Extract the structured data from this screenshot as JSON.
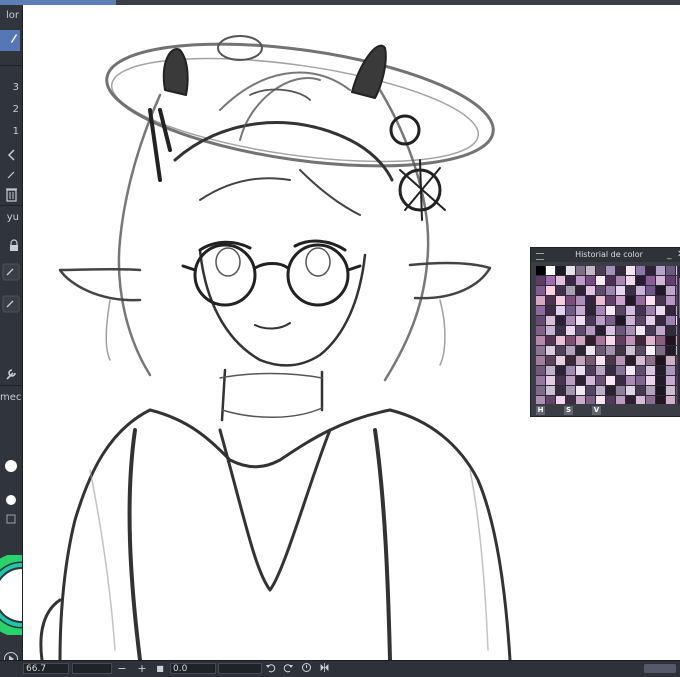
{
  "app": {
    "left_panel": {
      "header_text": "lor",
      "numbers": [
        "3",
        "2",
        "1"
      ],
      "labels": [
        "yu",
        "mec"
      ]
    },
    "icons": [
      "trash-icon",
      "lock-icon",
      "wrench-icon",
      "color-wheel-icon",
      "play-icon",
      "undo-icon",
      "redo-icon",
      "reset-rotation-icon",
      "flip-icon"
    ],
    "accent_color": "#5577b6"
  },
  "status_bar": {
    "zoom_value": "66.7",
    "zoom_out_label": "−",
    "zoom_in_label": "+",
    "stop_label": "■",
    "rotation_value": "0.0"
  },
  "palette_window": {
    "title": "Historial de color",
    "minimize_label": "_",
    "close_label": "✕",
    "footer_buttons": [
      "H",
      "S",
      "V"
    ],
    "swatch_colors": [
      "#000000",
      "#ffffff",
      "#1d1b22",
      "#e8e3ea",
      "#7d6f86",
      "#c2b8c7",
      "#4a3f52",
      "#a592b8",
      "#312a3a",
      "#f4e6f0",
      "#8c79a6",
      "#2d2338",
      "#b6a2c6",
      "#6a5b7a",
      "#d9c7e0",
      "#5a3e63",
      "#9b6fa8",
      "#e0c1d8",
      "#3b2745",
      "#c09ac7",
      "#774b80",
      "#fbe9f4",
      "#4e3056",
      "#a887b5",
      "#efd8e8",
      "#291b31",
      "#8a5e95",
      "#d4b4d6",
      "#613f6c",
      "#b28fbf",
      "#7e5f8f",
      "#fcd1dc",
      "#40324c",
      "#a7a1b3",
      "#2a2435",
      "#dfc3e3",
      "#5c4b6b",
      "#9e86b0",
      "#e6d7ec",
      "#3a2f46",
      "#c7b4d4",
      "#70598a",
      "#1f1a27",
      "#bba8c9",
      "#826d98",
      "#d6a9c2",
      "#4b3253",
      "#f2cde0",
      "#7a4d7c",
      "#ab8fbb",
      "#34233c",
      "#e9bcd2",
      "#5f426b",
      "#c9a3c9",
      "#221828",
      "#926a9c",
      "#fbe2ee",
      "#48354f",
      "#b797c4",
      "#6d4d78",
      "#8e6b9d",
      "#3c2d47",
      "#e3d0ea",
      "#6f5c80",
      "#c4aed0",
      "#2e2438",
      "#a487b2",
      "#f6e9f3",
      "#564464",
      "#d2bbdc",
      "#423350",
      "#9c81ad",
      "#ecdcef",
      "#31263b",
      "#bfa9cb",
      "#654a73",
      "#d8bfd9",
      "#2b1f33",
      "#a98bb5",
      "#f0dff0",
      "#4a3857",
      "#bb9fc6",
      "#7a5f88",
      "#1d1624",
      "#cdb3d6",
      "#5b4567",
      "#e5cfe6",
      "#37283f",
      "#9f82ad",
      "#f9eef7",
      "#7d6289",
      "#c9b3d2",
      "#3e3048",
      "#ead9ee",
      "#5e4a6c",
      "#b39cc0",
      "#271e2f",
      "#d7c3df",
      "#6c5679",
      "#a890b5",
      "#f3e7f4",
      "#493a55",
      "#c0a8ca",
      "#342a3d",
      "#8f769c",
      "#b48aa8",
      "#52364f",
      "#e6c0d4",
      "#7a506f",
      "#cfa6c0",
      "#2f1e2c",
      "#a47698",
      "#f4dbe8",
      "#603f5a",
      "#be94b2",
      "#3d2739",
      "#dcb6cb",
      "#86607d",
      "#1f141d",
      "#c79fb9",
      "#8a7694",
      "#d9cddd",
      "#4f4158",
      "#b4a4bb",
      "#2d2531",
      "#eee5ef",
      "#6b5b73",
      "#a392aa",
      "#3f3545",
      "#cfc1d3",
      "#5a4b61",
      "#f8f2f8",
      "#7d6b84",
      "#221b25",
      "#bfb0c4",
      "#a0809e",
      "#5b4259",
      "#e8cfe2",
      "#3a2738",
      "#c3a4bd",
      "#755a72",
      "#f6e5f1",
      "#4b3549",
      "#b695b0",
      "#2a1c29",
      "#d7bdd1",
      "#8c6f88",
      "#1e141d",
      "#cbb0c6",
      "#604862",
      "#6f5a7e",
      "#c0b0cc",
      "#2c2336",
      "#9e8bae",
      "#e9def0",
      "#4d3f5a",
      "#b7a5c4",
      "#372c41",
      "#857398",
      "#f2eaf6",
      "#5e4d6c",
      "#d3c5dd",
      "#231c2b",
      "#a897b6",
      "#413650",
      "#94789e",
      "#e2cbe5",
      "#453450",
      "#ba9fc3",
      "#2b2132",
      "#d0b9d6",
      "#6a5273",
      "#fae9f5",
      "#3a2b41",
      "#a98ab3",
      "#7f668a",
      "#ead4ea",
      "#251a29",
      "#c5acc9",
      "#574361",
      "#7d6c88",
      "#cdc0d6",
      "#362e3f",
      "#a697b1",
      "#f0e9f3",
      "#514561",
      "#bcaec6",
      "#2a232f",
      "#8f7f9a",
      "#dfd3e6",
      "#443a4f",
      "#b1a1bd",
      "#1c171f",
      "#c9bdd0",
      "#66577a",
      "#ab90b2",
      "#5d4766",
      "#efd6ec",
      "#3c2c44",
      "#c8acc8",
      "#7c6282",
      "#f5e4f2",
      "#4f3a58",
      "#b99cbe",
      "#2c1f31",
      "#d8bdd7",
      "#8a6d90",
      "#211724",
      "#cdb1cd",
      "#645069"
    ]
  }
}
